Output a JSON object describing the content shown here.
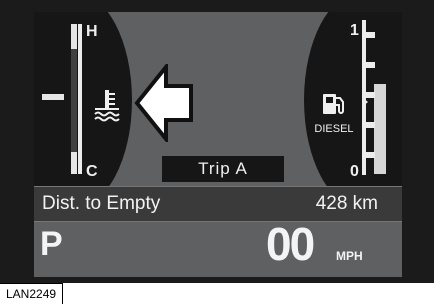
{
  "temperature_gauge": {
    "high_label": "H",
    "low_label": "C",
    "warning": "high-temperature-arrow"
  },
  "fuel_gauge": {
    "full_label": "1",
    "empty_label": "0",
    "fuel_type": "DIESEL",
    "level_fraction": 0.6
  },
  "trip": {
    "label": "Trip  A"
  },
  "distance_to_empty": {
    "label": "Dist. to Empty",
    "value": "428 km"
  },
  "drive": {
    "gear": "P",
    "speed": "00",
    "unit": "MPH"
  },
  "caption": "LAN2249",
  "colors": {
    "screen": "#5f6061",
    "frame": "#1b1b1b",
    "text": "#f2f2f2"
  }
}
